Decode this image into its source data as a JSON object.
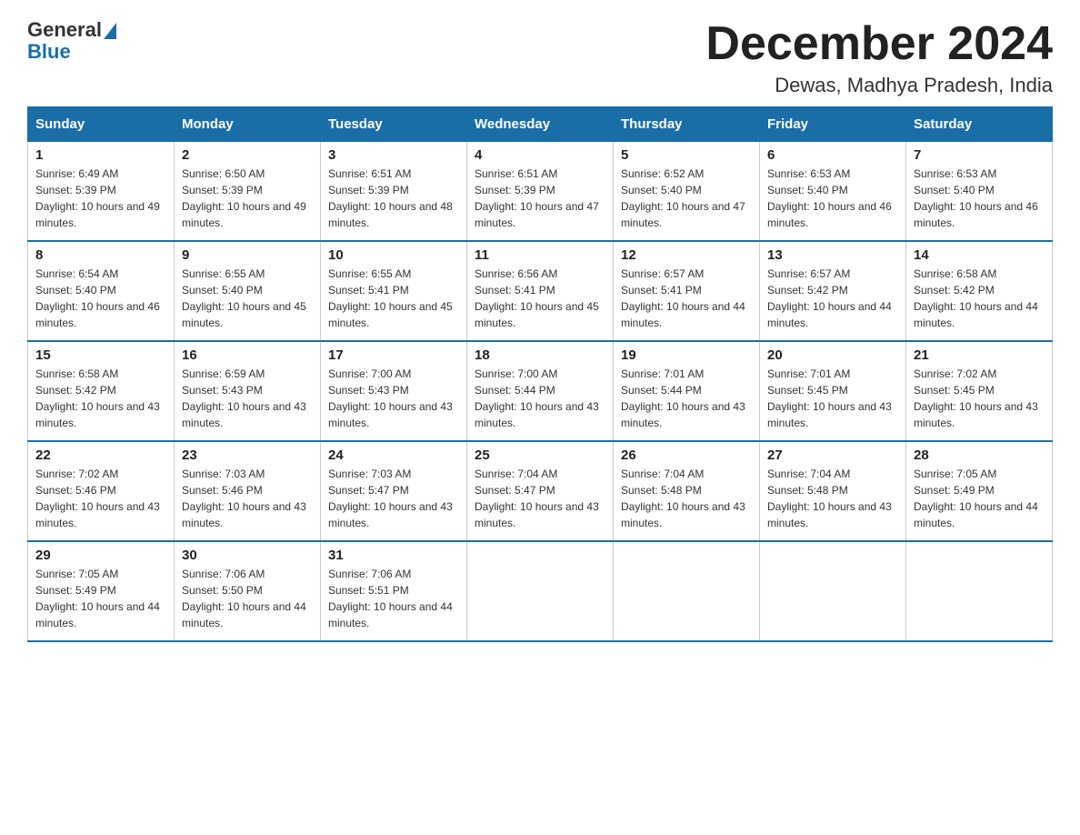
{
  "logo": {
    "general": "General",
    "blue": "Blue"
  },
  "title": "December 2024",
  "subtitle": "Dewas, Madhya Pradesh, India",
  "days_of_week": [
    "Sunday",
    "Monday",
    "Tuesday",
    "Wednesday",
    "Thursday",
    "Friday",
    "Saturday"
  ],
  "weeks": [
    [
      {
        "day": "1",
        "sunrise": "6:49 AM",
        "sunset": "5:39 PM",
        "daylight": "10 hours and 49 minutes."
      },
      {
        "day": "2",
        "sunrise": "6:50 AM",
        "sunset": "5:39 PM",
        "daylight": "10 hours and 49 minutes."
      },
      {
        "day": "3",
        "sunrise": "6:51 AM",
        "sunset": "5:39 PM",
        "daylight": "10 hours and 48 minutes."
      },
      {
        "day": "4",
        "sunrise": "6:51 AM",
        "sunset": "5:39 PM",
        "daylight": "10 hours and 47 minutes."
      },
      {
        "day": "5",
        "sunrise": "6:52 AM",
        "sunset": "5:40 PM",
        "daylight": "10 hours and 47 minutes."
      },
      {
        "day": "6",
        "sunrise": "6:53 AM",
        "sunset": "5:40 PM",
        "daylight": "10 hours and 46 minutes."
      },
      {
        "day": "7",
        "sunrise": "6:53 AM",
        "sunset": "5:40 PM",
        "daylight": "10 hours and 46 minutes."
      }
    ],
    [
      {
        "day": "8",
        "sunrise": "6:54 AM",
        "sunset": "5:40 PM",
        "daylight": "10 hours and 46 minutes."
      },
      {
        "day": "9",
        "sunrise": "6:55 AM",
        "sunset": "5:40 PM",
        "daylight": "10 hours and 45 minutes."
      },
      {
        "day": "10",
        "sunrise": "6:55 AM",
        "sunset": "5:41 PM",
        "daylight": "10 hours and 45 minutes."
      },
      {
        "day": "11",
        "sunrise": "6:56 AM",
        "sunset": "5:41 PM",
        "daylight": "10 hours and 45 minutes."
      },
      {
        "day": "12",
        "sunrise": "6:57 AM",
        "sunset": "5:41 PM",
        "daylight": "10 hours and 44 minutes."
      },
      {
        "day": "13",
        "sunrise": "6:57 AM",
        "sunset": "5:42 PM",
        "daylight": "10 hours and 44 minutes."
      },
      {
        "day": "14",
        "sunrise": "6:58 AM",
        "sunset": "5:42 PM",
        "daylight": "10 hours and 44 minutes."
      }
    ],
    [
      {
        "day": "15",
        "sunrise": "6:58 AM",
        "sunset": "5:42 PM",
        "daylight": "10 hours and 43 minutes."
      },
      {
        "day": "16",
        "sunrise": "6:59 AM",
        "sunset": "5:43 PM",
        "daylight": "10 hours and 43 minutes."
      },
      {
        "day": "17",
        "sunrise": "7:00 AM",
        "sunset": "5:43 PM",
        "daylight": "10 hours and 43 minutes."
      },
      {
        "day": "18",
        "sunrise": "7:00 AM",
        "sunset": "5:44 PM",
        "daylight": "10 hours and 43 minutes."
      },
      {
        "day": "19",
        "sunrise": "7:01 AM",
        "sunset": "5:44 PM",
        "daylight": "10 hours and 43 minutes."
      },
      {
        "day": "20",
        "sunrise": "7:01 AM",
        "sunset": "5:45 PM",
        "daylight": "10 hours and 43 minutes."
      },
      {
        "day": "21",
        "sunrise": "7:02 AM",
        "sunset": "5:45 PM",
        "daylight": "10 hours and 43 minutes."
      }
    ],
    [
      {
        "day": "22",
        "sunrise": "7:02 AM",
        "sunset": "5:46 PM",
        "daylight": "10 hours and 43 minutes."
      },
      {
        "day": "23",
        "sunrise": "7:03 AM",
        "sunset": "5:46 PM",
        "daylight": "10 hours and 43 minutes."
      },
      {
        "day": "24",
        "sunrise": "7:03 AM",
        "sunset": "5:47 PM",
        "daylight": "10 hours and 43 minutes."
      },
      {
        "day": "25",
        "sunrise": "7:04 AM",
        "sunset": "5:47 PM",
        "daylight": "10 hours and 43 minutes."
      },
      {
        "day": "26",
        "sunrise": "7:04 AM",
        "sunset": "5:48 PM",
        "daylight": "10 hours and 43 minutes."
      },
      {
        "day": "27",
        "sunrise": "7:04 AM",
        "sunset": "5:48 PM",
        "daylight": "10 hours and 43 minutes."
      },
      {
        "day": "28",
        "sunrise": "7:05 AM",
        "sunset": "5:49 PM",
        "daylight": "10 hours and 44 minutes."
      }
    ],
    [
      {
        "day": "29",
        "sunrise": "7:05 AM",
        "sunset": "5:49 PM",
        "daylight": "10 hours and 44 minutes."
      },
      {
        "day": "30",
        "sunrise": "7:06 AM",
        "sunset": "5:50 PM",
        "daylight": "10 hours and 44 minutes."
      },
      {
        "day": "31",
        "sunrise": "7:06 AM",
        "sunset": "5:51 PM",
        "daylight": "10 hours and 44 minutes."
      },
      null,
      null,
      null,
      null
    ]
  ]
}
